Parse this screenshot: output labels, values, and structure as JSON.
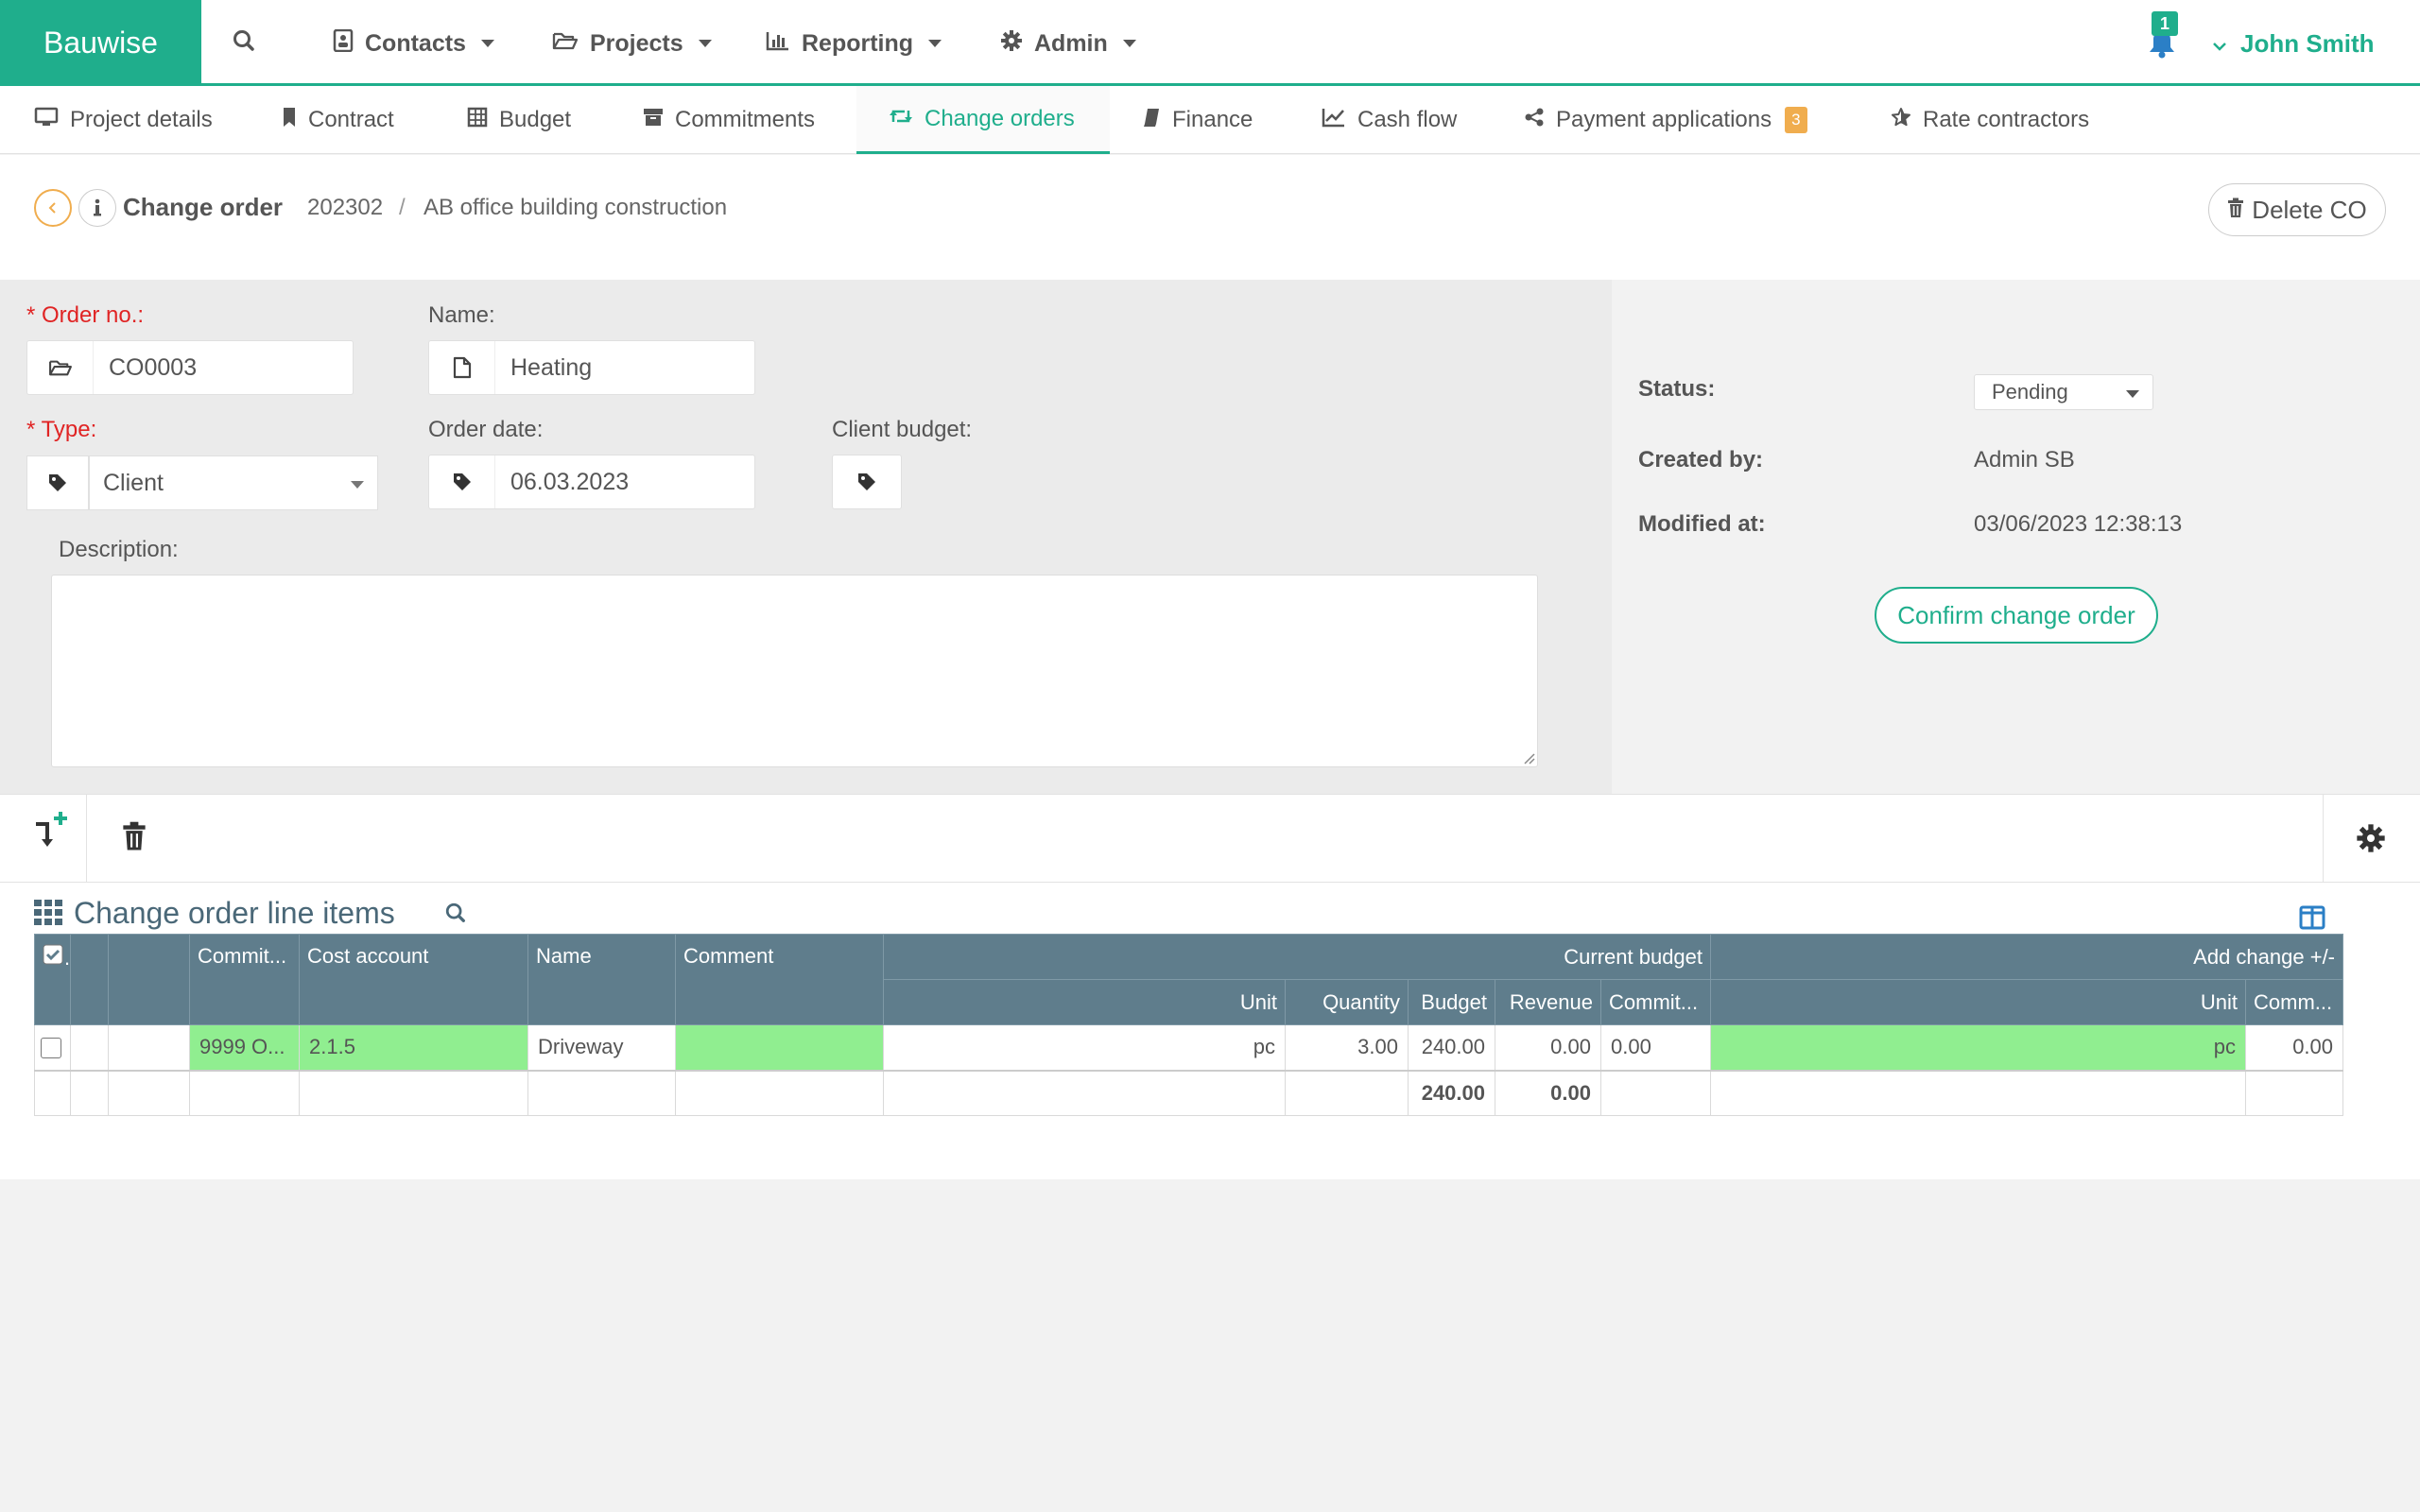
{
  "brand": "Bauwise",
  "nav": {
    "items": [
      {
        "label": "Contacts",
        "icon": "contact-card-icon"
      },
      {
        "label": "Projects",
        "icon": "folder-open-icon"
      },
      {
        "label": "Reporting",
        "icon": "bar-chart-icon"
      },
      {
        "label": "Admin",
        "icon": "gear-icon"
      }
    ],
    "notifications_count": "1",
    "user_name": "John Smith"
  },
  "tabs": [
    {
      "label": "Project details",
      "icon": "monitor-icon"
    },
    {
      "label": "Contract",
      "icon": "bookmark-icon"
    },
    {
      "label": "Budget",
      "icon": "table-icon"
    },
    {
      "label": "Commitments",
      "icon": "archive-icon"
    },
    {
      "label": "Change orders",
      "icon": "retweet-icon",
      "active": true
    },
    {
      "label": "Finance",
      "icon": "book-icon"
    },
    {
      "label": "Cash flow",
      "icon": "line-chart-icon"
    },
    {
      "label": "Payment applications",
      "icon": "share-icon",
      "badge": "3"
    },
    {
      "label": "Rate contractors",
      "icon": "star-icon"
    }
  ],
  "header": {
    "title": "Change order",
    "project_no": "202302",
    "separator": "/",
    "project_name": "AB office building construction",
    "delete_label": "Delete CO"
  },
  "form": {
    "order_no_label": "* Order no.:",
    "order_no_value": "CO0003",
    "name_label": "Name:",
    "name_value": "Heating",
    "type_label": "* Type:",
    "type_value": "Client",
    "order_date_label": "Order date:",
    "order_date_value": "06.03.2023",
    "client_budget_label": "Client budget:",
    "description_label": "Description:",
    "description_value": ""
  },
  "status_panel": {
    "status_label": "Status:",
    "status_value": "Pending",
    "created_by_label": "Created by:",
    "created_by_value": "Admin SB",
    "modified_at_label": "Modified at:",
    "modified_at_value": "03/06/2023 12:38:13",
    "confirm_label": "Confirm change order"
  },
  "grid": {
    "title": "Change order line items",
    "group_headers": {
      "current_budget": "Current budget",
      "add_change": "Add change +/-"
    },
    "columns": {
      "commitment": "Commit...",
      "cost_account": "Cost account",
      "name": "Name",
      "comment": "Comment",
      "unit": "Unit",
      "quantity": "Quantity",
      "budget": "Budget",
      "revenue": "Revenue",
      "commit2": "Commit...",
      "add_unit": "Unit",
      "add_comm": "Comm..."
    },
    "rows": [
      {
        "commitment": "9999 O...",
        "cost_account": "2.1.5",
        "name": "Driveway",
        "comment": "",
        "unit": "pc",
        "quantity": "3.00",
        "budget": "240.00",
        "revenue": "0.00",
        "commit2": "0.00",
        "add_unit": "pc",
        "add_comm": "0.00"
      }
    ],
    "totals": {
      "budget": "240.00",
      "revenue": "0.00"
    }
  },
  "colors": {
    "accent": "#1fae8c",
    "grid_header": "#5f7d8c",
    "highlight": "#90ee90",
    "badge": "#f0ad4e",
    "required": "#e02424"
  }
}
